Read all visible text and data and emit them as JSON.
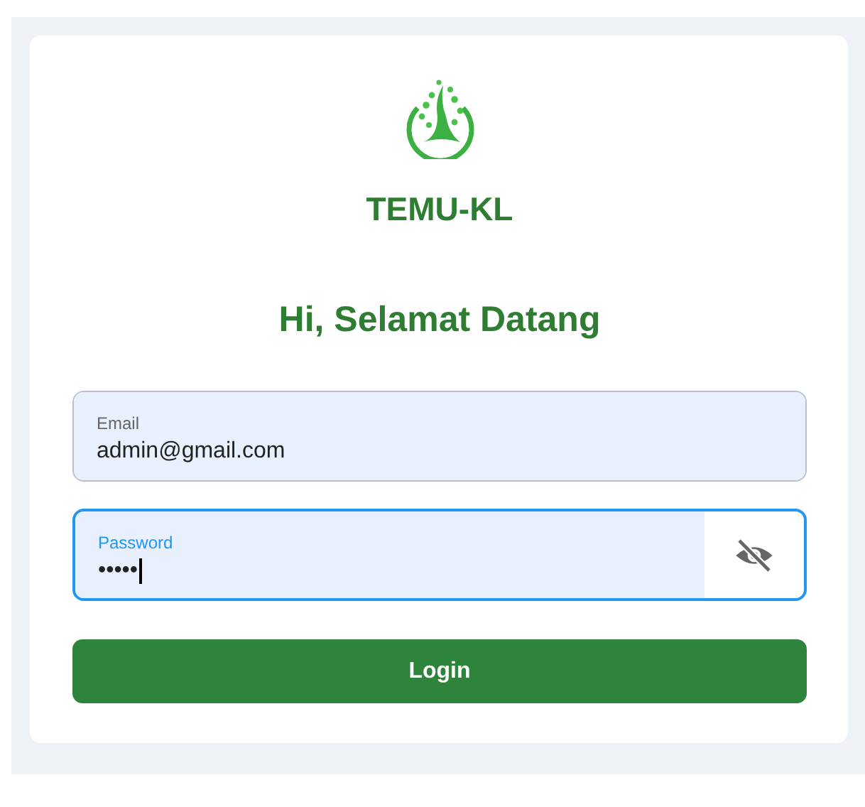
{
  "app_name": "TEMU-KL",
  "greeting": "Hi, Selamat Datang",
  "fields": [
    {
      "kind": "text",
      "label": "Email",
      "value": "admin@gmail.com",
      "focused": false
    },
    {
      "kind": "password",
      "label": "Password",
      "value": "•••••",
      "focused": true
    }
  ],
  "login_button": "Login"
}
